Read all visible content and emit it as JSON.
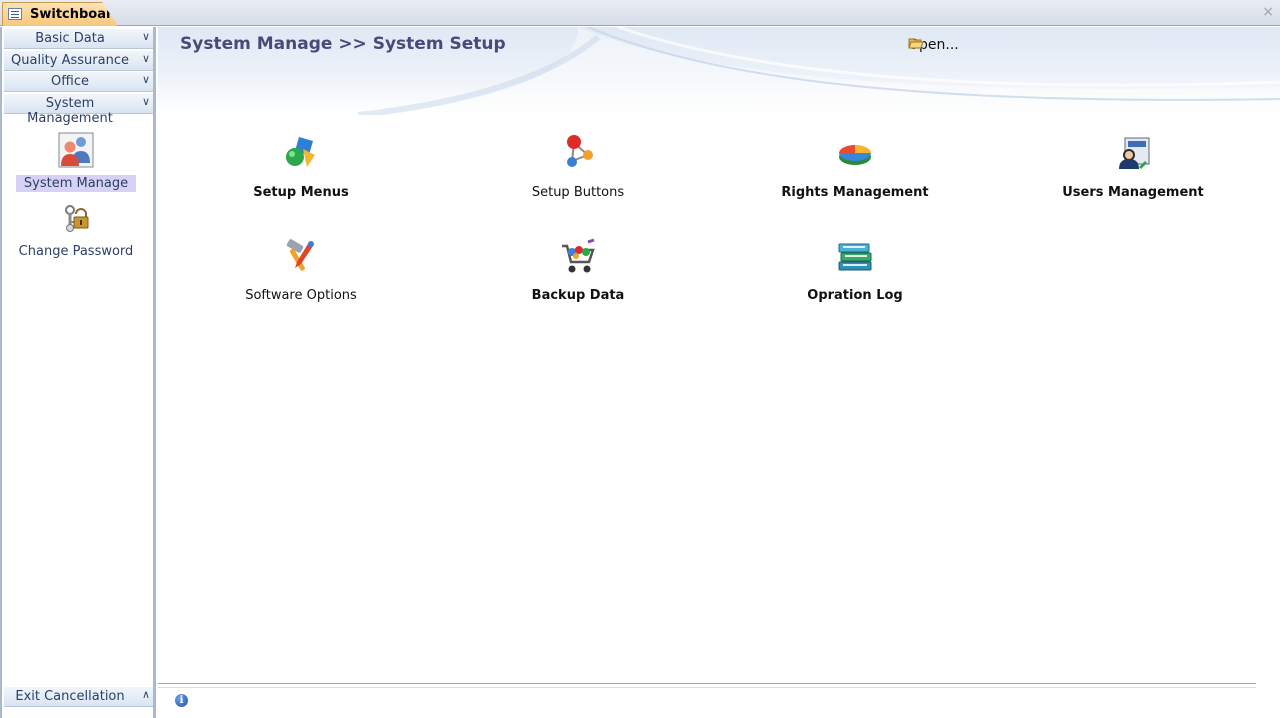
{
  "window": {
    "tab_title": "Switchboard",
    "close_glyph": "×"
  },
  "nav": {
    "groups": [
      {
        "label": "Basic Data",
        "chevron": "»"
      },
      {
        "label": "Quality Assurance",
        "chevron": "»"
      },
      {
        "label": "Office",
        "chevron": "»"
      },
      {
        "label": "System Management",
        "chevron": "»"
      }
    ],
    "items": [
      {
        "label": "System Manage",
        "icon": "users-icon",
        "selected": true
      },
      {
        "label": "Change Password",
        "icon": "lock-key-icon",
        "selected": false
      }
    ],
    "footer": {
      "label": "Exit Cancellation",
      "chevron": "«"
    }
  },
  "header": {
    "breadcrumb": "System Manage >> System Setup",
    "open_label": "Open...",
    "open_icon": "folder-open-icon"
  },
  "tiles": [
    {
      "label": "Setup Menus",
      "icon": "shapes-icon",
      "bold": true
    },
    {
      "label": "Setup Buttons",
      "icon": "molecule-icon",
      "bold": false
    },
    {
      "label": "Rights Management",
      "icon": "pie-chart-icon",
      "bold": true
    },
    {
      "label": "Users Management",
      "icon": "admin-user-icon",
      "bold": true
    },
    {
      "label": "Software Options",
      "icon": "tools-icon",
      "bold": false
    },
    {
      "label": "Backup Data",
      "icon": "cart-icon",
      "bold": true
    },
    {
      "label": "Opration Log",
      "icon": "books-icon",
      "bold": true
    }
  ],
  "status": {
    "icon": "info-icon",
    "glyph": "i"
  },
  "colors": {
    "nav_selected": "#d7d2f5",
    "title_color": "#4a4a7a",
    "tab_orange": "#f7c77c"
  }
}
